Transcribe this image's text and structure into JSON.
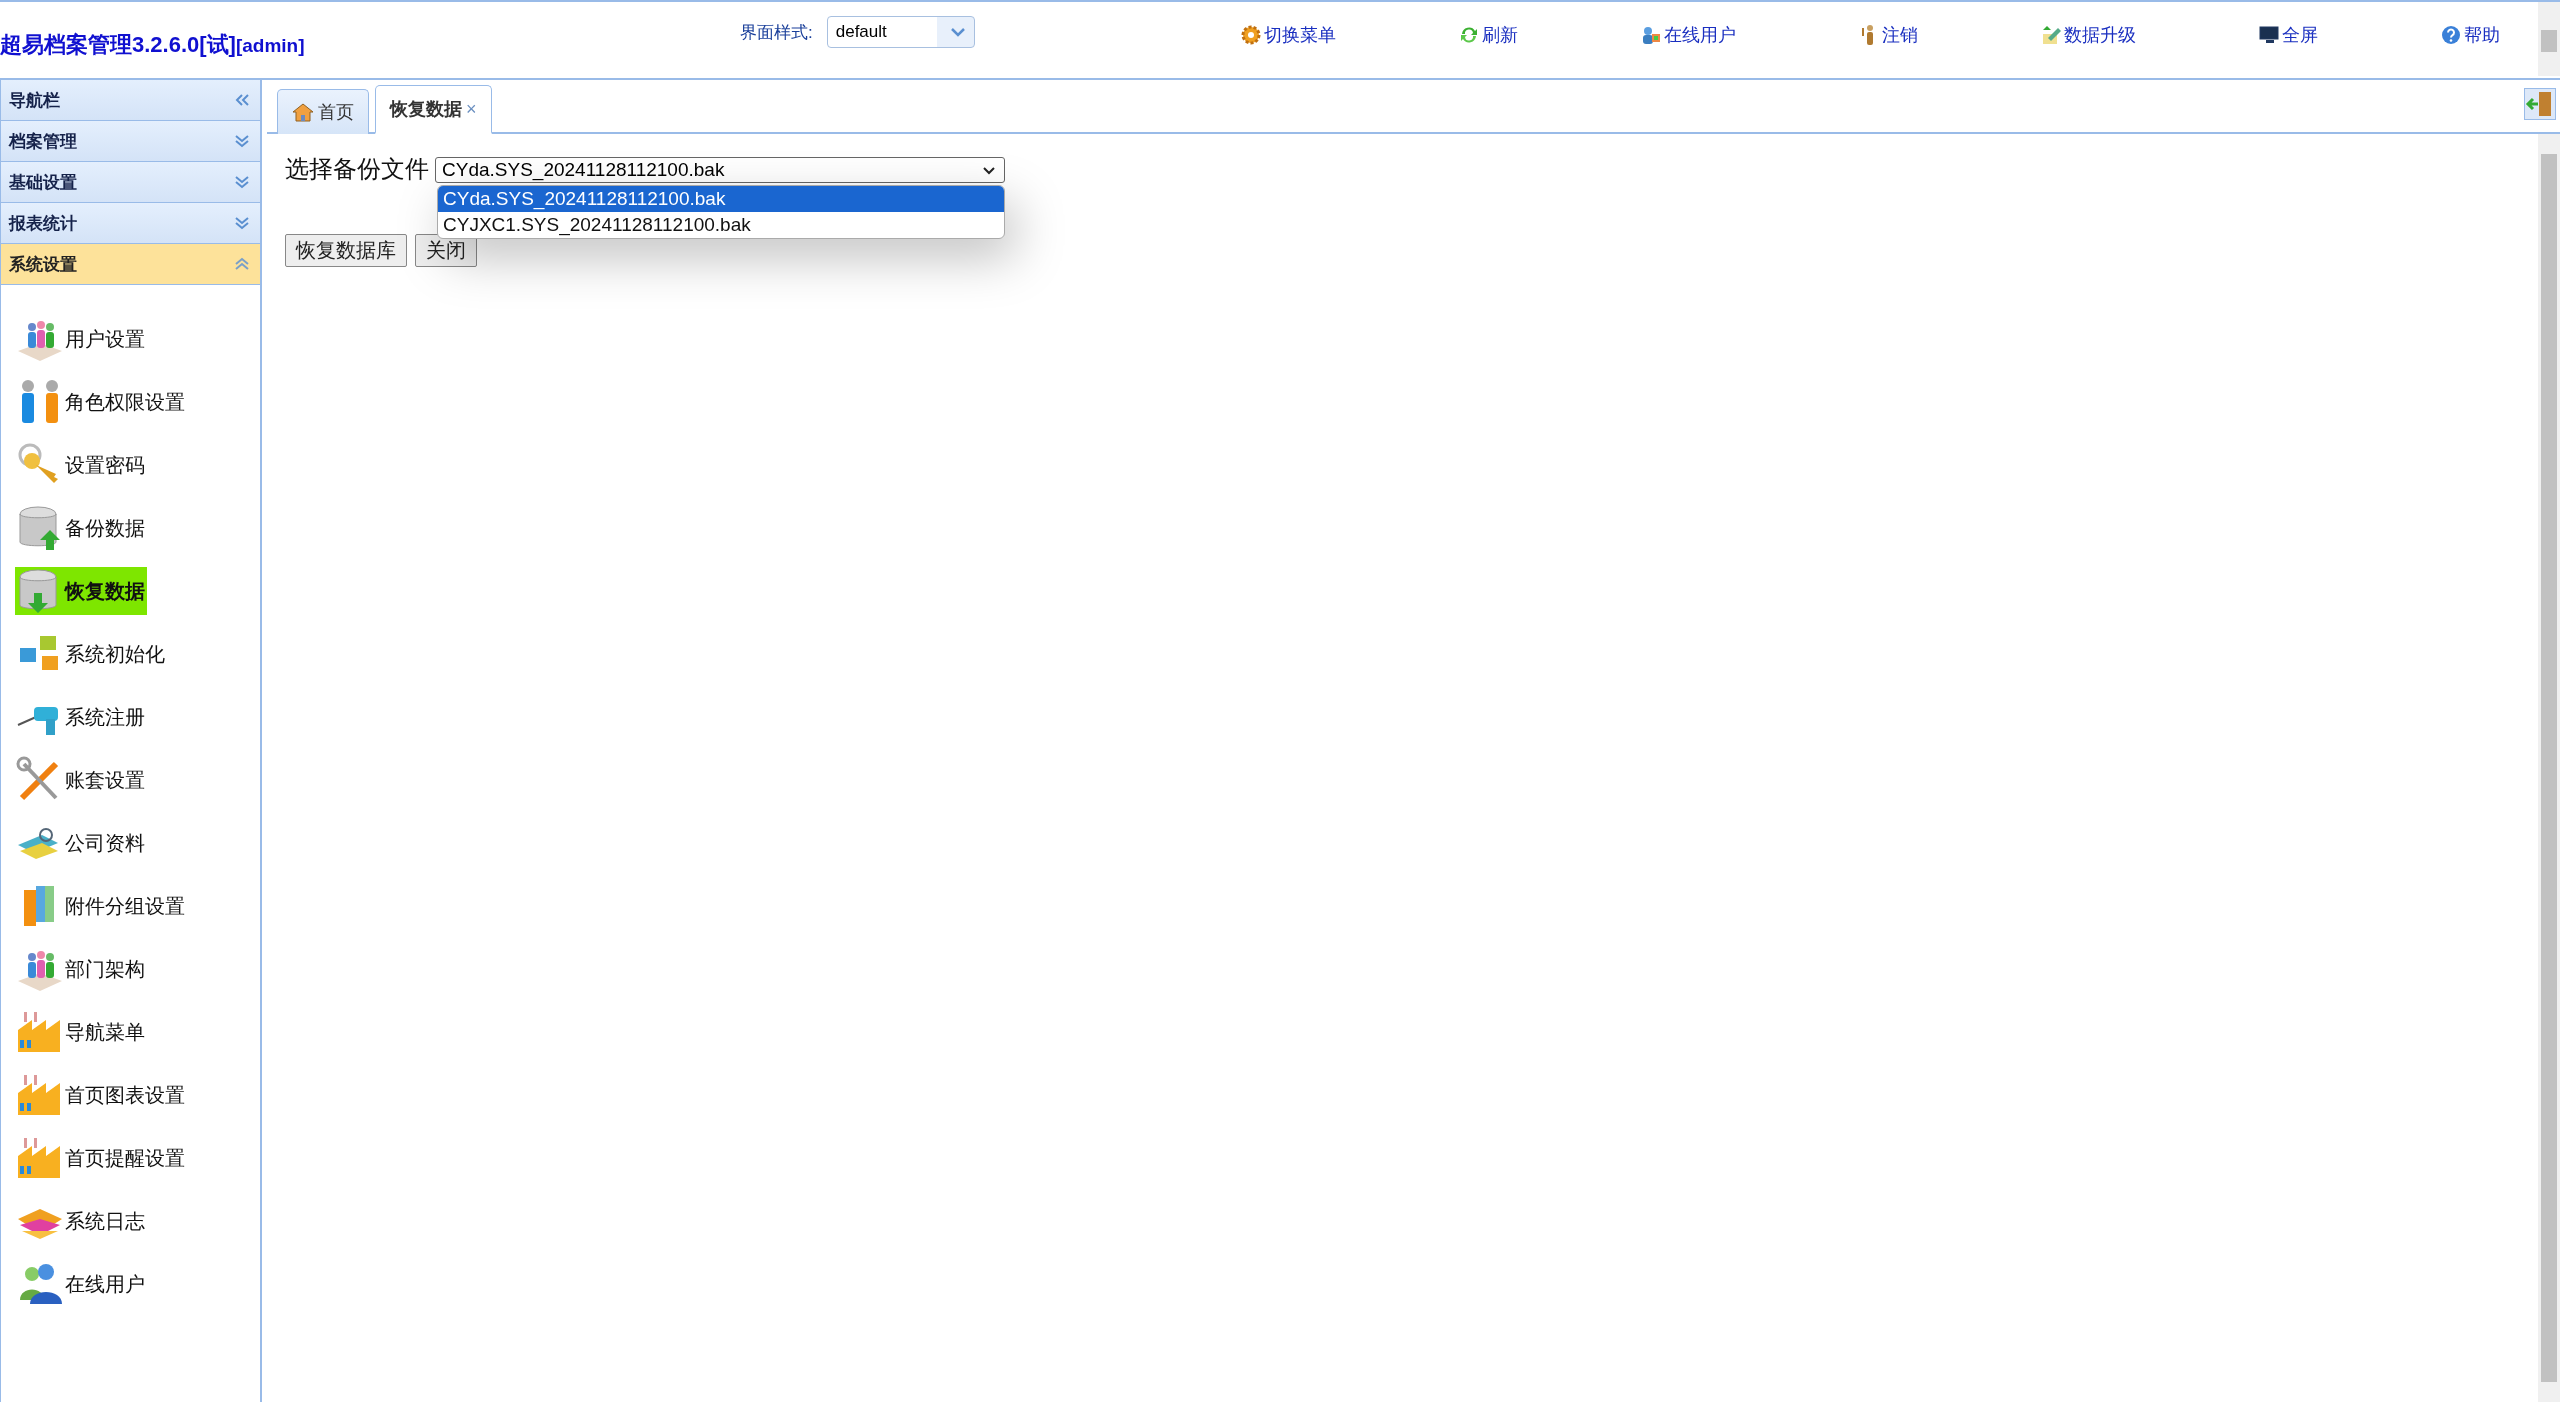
{
  "header": {
    "app_title": "超易档案管理3.2.6.0[试]",
    "user_tag": "[admin]",
    "theme": {
      "label": "界面样式:",
      "value": "default"
    },
    "toolbar": [
      {
        "label": "切换菜单"
      },
      {
        "label": "刷新"
      },
      {
        "label": "在线用户"
      },
      {
        "label": "注销"
      },
      {
        "label": "数据升级"
      },
      {
        "label": "全屏"
      },
      {
        "label": "帮助"
      }
    ]
  },
  "sidebar": {
    "title": "导航栏",
    "groups": [
      {
        "label": "档案管理",
        "expanded": false
      },
      {
        "label": "基础设置",
        "expanded": false
      },
      {
        "label": "报表统计",
        "expanded": false
      },
      {
        "label": "系统设置",
        "expanded": true,
        "items": [
          {
            "label": "用户设置",
            "selected": false
          },
          {
            "label": "角色权限设置",
            "selected": false
          },
          {
            "label": "设置密码",
            "selected": false
          },
          {
            "label": "备份数据",
            "selected": false
          },
          {
            "label": "恢复数据",
            "selected": true
          },
          {
            "label": "系统初始化",
            "selected": false
          },
          {
            "label": "系统注册",
            "selected": false
          },
          {
            "label": "账套设置",
            "selected": false
          },
          {
            "label": "公司资料",
            "selected": false
          },
          {
            "label": "附件分组设置",
            "selected": false
          },
          {
            "label": "部门架构",
            "selected": false
          },
          {
            "label": "导航菜单",
            "selected": false
          },
          {
            "label": "首页图表设置",
            "selected": false
          },
          {
            "label": "首页提醒设置",
            "selected": false
          },
          {
            "label": "系统日志",
            "selected": false
          },
          {
            "label": "在线用户",
            "selected": false
          }
        ]
      }
    ]
  },
  "tabs": [
    {
      "label": "首页",
      "selected": false
    },
    {
      "label": "恢复数据",
      "selected": true,
      "close": "×"
    }
  ],
  "restore_form": {
    "label": "选择备份文件",
    "select_value": "CYda.SYS_20241128112100.bak",
    "options": [
      {
        "label": "CYda.SYS_20241128112100.bak",
        "selected": true
      },
      {
        "label": "CYJXC1.SYS_20241128112100.bak",
        "selected": false
      }
    ],
    "buttons": [
      "恢复数据库",
      "关闭"
    ]
  }
}
